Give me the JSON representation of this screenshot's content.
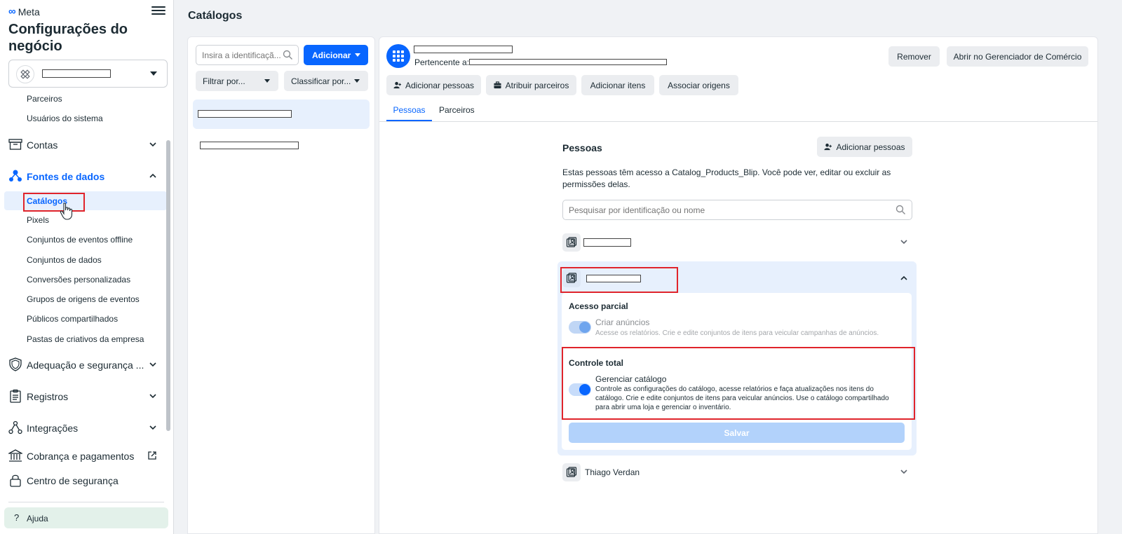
{
  "sidebar": {
    "brand": "Meta",
    "title": "Configurações do negócio",
    "items_top": [
      "Parceiros",
      "Usuários do sistema"
    ],
    "sections": {
      "contas": "Contas",
      "fontes": "Fontes de dados",
      "adequacao": "Adequação e segurança ...",
      "registros": "Registros",
      "integracoes": "Integrações",
      "cobranca": "Cobrança e pagamentos",
      "seguranca": "Centro de segurança"
    },
    "fontes_items": {
      "catalogos": "Catálogos",
      "pixels": "Pixels",
      "offline": "Conjuntos de eventos offline",
      "conjuntos": "Conjuntos de dados",
      "conversoes": "Conversões personalizadas",
      "grupos": "Grupos de origens de eventos",
      "publicos": "Públicos compartilhados",
      "pastas": "Pastas de criativos da empresa"
    },
    "help": "Ajuda"
  },
  "page": {
    "title": "Catálogos"
  },
  "list": {
    "search_placeholder": "Insira a identificaçã...",
    "add_label": "Adicionar",
    "filter_label": "Filtrar por...",
    "sort_label": "Classificar por..."
  },
  "detail": {
    "owner_label": "Pertencente a:",
    "remove_label": "Remover",
    "open_commerce_label": "Abrir no Gerenciador de Comércio",
    "actions": {
      "add_people": "Adicionar pessoas",
      "assign_partners": "Atribuir parceiros",
      "add_items": "Adicionar itens",
      "associate_sources": "Associar origens"
    },
    "tabs": {
      "people": "Pessoas",
      "partners": "Parceiros"
    },
    "people": {
      "title": "Pessoas",
      "add_button": "Adicionar pessoas",
      "description": "Estas pessoas têm acesso a Catalog_Products_Blip. Você pode ver, editar ou excluir as permissões delas.",
      "search_placeholder": "Pesquisar por identificação ou nome",
      "last_person": "Thiago Verdan"
    },
    "permissions": {
      "partial_heading": "Acesso parcial",
      "partial_title": "Criar anúncios",
      "partial_desc": "Acesse os relatórios. Crie e edite conjuntos de itens para veicular campanhas de anúncios.",
      "full_heading": "Controle total",
      "full_title": "Gerenciar catálogo",
      "full_desc": "Controle as configurações do catálogo, acesse relatórios e faça atualizações nos itens do catálogo. Crie e edite conjuntos de itens para veicular anúncios. Use o catálogo compartilhado para abrir uma loja e gerenciar o inventário.",
      "save_label": "Salvar"
    }
  },
  "colors": {
    "accent": "#0866ff",
    "highlight": "#e7f0fd",
    "annotation_red": "#e0242b"
  }
}
